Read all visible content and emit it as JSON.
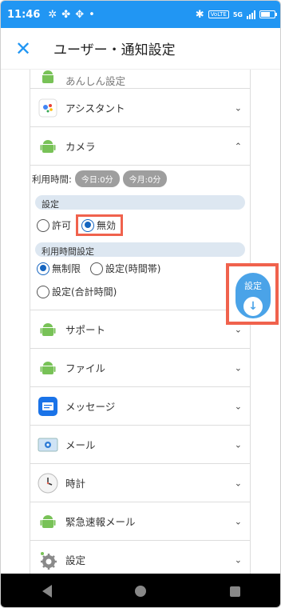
{
  "status": {
    "time": "11:46",
    "network": "5G",
    "volte": "VoLTE"
  },
  "header": {
    "close_icon": "close-icon",
    "title": "ユーザー・通知設定"
  },
  "list": {
    "partial_item": "あんしん設定",
    "items": [
      {
        "label": "アシスタント",
        "icon": "assistant-icon"
      },
      {
        "label": "カメラ",
        "icon": "android-icon",
        "expanded": true
      },
      {
        "label": "サポート",
        "icon": "android-icon"
      },
      {
        "label": "ファイル",
        "icon": "android-icon"
      },
      {
        "label": "メッセージ",
        "icon": "message-icon"
      },
      {
        "label": "メール",
        "icon": "mail-icon"
      },
      {
        "label": "時計",
        "icon": "clock-icon"
      },
      {
        "label": "緊急速報メール",
        "icon": "android-icon"
      },
      {
        "label": "設定",
        "icon": "settings-gear-icon"
      }
    ]
  },
  "camera_detail": {
    "usage_label": "利用時間:",
    "today": "今日:0分",
    "month": "今月:0分",
    "settings_label": "設定",
    "allow": "許可",
    "deny": "無効",
    "selected": "無効",
    "time_settings_label": "利用時間設定",
    "unlimited": "無制限",
    "time_band": "設定(時間帯)",
    "total_time": "設定(合計時間)",
    "time_selected": "無制限"
  },
  "fab": {
    "label": "設定"
  },
  "colors": {
    "accent": "#2196f3",
    "highlight": "#f0624d",
    "android": "#78c257"
  }
}
